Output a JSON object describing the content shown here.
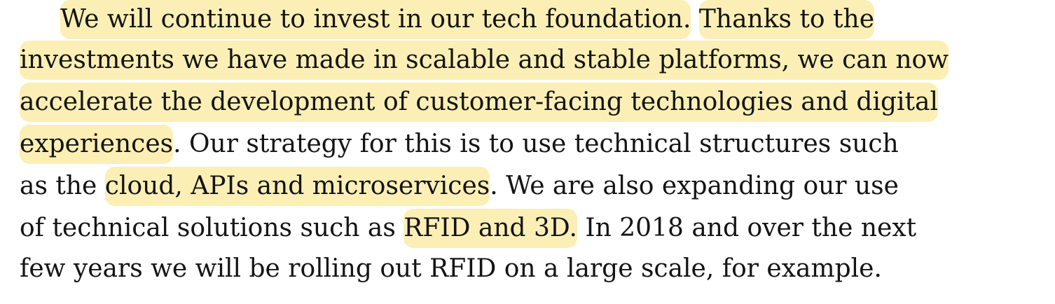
{
  "paragraph": {
    "lines": [
      {
        "segments": [
          {
            "text": "We will continue to invest in our tech foundation.",
            "highlight": true
          },
          {
            "text": " ",
            "highlight": false
          },
          {
            "text": "Thanks to the",
            "highlight": true
          }
        ]
      },
      {
        "segments": [
          {
            "text": "investments we have made in scalable and stable platforms, we can now",
            "highlight": true
          }
        ]
      },
      {
        "segments": [
          {
            "text": "accelerate the development of customer-facing technologies and digital",
            "highlight": true
          }
        ]
      },
      {
        "segments": [
          {
            "text": "experiences",
            "highlight": true
          },
          {
            "text": ". Our strategy for this is to use technical structures such",
            "highlight": false
          }
        ]
      },
      {
        "segments": [
          {
            "text": "as the ",
            "highlight": false
          },
          {
            "text": "cloud, APIs and microservices",
            "highlight": true
          },
          {
            "text": ". We are also expanding our use",
            "highlight": false
          }
        ]
      },
      {
        "segments": [
          {
            "text": "of technical solutions such as ",
            "highlight": false
          },
          {
            "text": "RFID and 3D.",
            "highlight": true
          },
          {
            "text": " In 2018 and over the next",
            "highlight": false
          }
        ]
      },
      {
        "segments": [
          {
            "text": "few years we will be rolling out RFID on a large scale, for example.",
            "highlight": false
          }
        ]
      }
    ]
  },
  "colors": {
    "highlight": "#fbefb5",
    "text": "#141414",
    "background": "#ffffff"
  }
}
